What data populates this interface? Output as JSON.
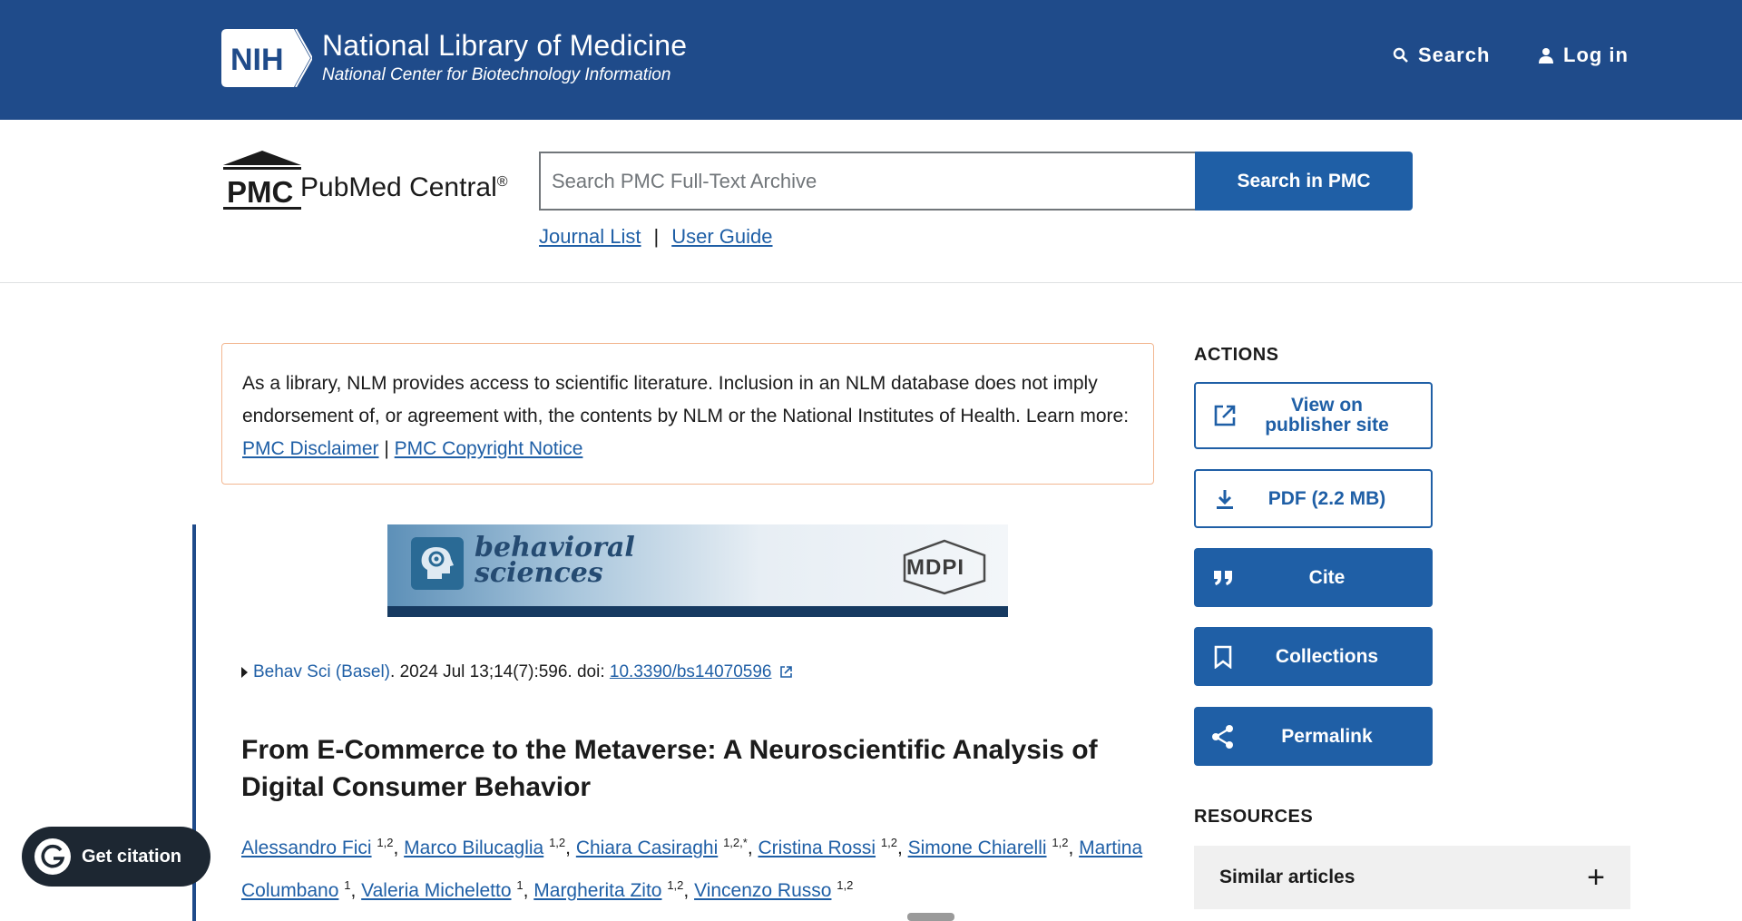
{
  "header": {
    "logo_text": "NIH",
    "title": "National Library of Medicine",
    "subtitle": "National Center for Biotechnology Information",
    "search_label": "Search",
    "login_label": "Log in"
  },
  "pmc": {
    "logo_text": "PMC",
    "name": "PubMed Central",
    "registered": "®",
    "search_placeholder": "Search PMC Full-Text Archive",
    "search_button": "Search in PMC",
    "links": [
      "Journal List",
      "User Guide"
    ],
    "separator": "|"
  },
  "disclaimer": {
    "text": "As a library, NLM provides access to scientific literature. Inclusion in an NLM database does not imply endorsement of, or agreement with, the contents by NLM or the National Institutes of Health.",
    "learn_more": "Learn more:",
    "link1": "PMC Disclaimer",
    "separator": "|",
    "link2": "PMC Copyright Notice"
  },
  "banner": {
    "journal_line1": "behavioral",
    "journal_line2": "sciences",
    "publisher": "MDPI"
  },
  "citation": {
    "journal": "Behav Sci (Basel)",
    "details": ". 2024 Jul 13;14(7):596. doi: ",
    "doi": "10.3390/bs14070596"
  },
  "article": {
    "title": "From E-Commerce to the Metaverse: A Neuroscientific Analysis of Digital Consumer Behavior",
    "authors": [
      {
        "name": "Alessandro Fici",
        "aff": "1,2"
      },
      {
        "name": "Marco Bilucaglia",
        "aff": "1,2"
      },
      {
        "name": "Chiara Casiraghi",
        "aff": "1,2,*"
      },
      {
        "name": "Cristina Rossi",
        "aff": "1,2"
      },
      {
        "name": "Simone Chiarelli",
        "aff": "1,2"
      },
      {
        "name": "Martina Columbano",
        "aff": "1"
      },
      {
        "name": "Valeria Micheletto",
        "aff": "1"
      },
      {
        "name": "Margherita Zito",
        "aff": "1,2"
      },
      {
        "name": "Vincenzo Russo",
        "aff": "1,2"
      }
    ]
  },
  "sidebar": {
    "actions_heading": "ACTIONS",
    "view_publisher_line1": "View on",
    "view_publisher_line2": "publisher site",
    "pdf": "PDF (2.2 MB)",
    "cite": "Cite",
    "collections": "Collections",
    "permalink": "Permalink",
    "resources_heading": "RESOURCES",
    "similar_articles": "Similar articles",
    "expand_symbol": "+"
  },
  "floating": {
    "get_citation": "Get citation"
  },
  "colors": {
    "nih_blue": "#1f4b8a",
    "action_blue": "#1f5fa6",
    "disclaimer_border": "#f2b791"
  }
}
